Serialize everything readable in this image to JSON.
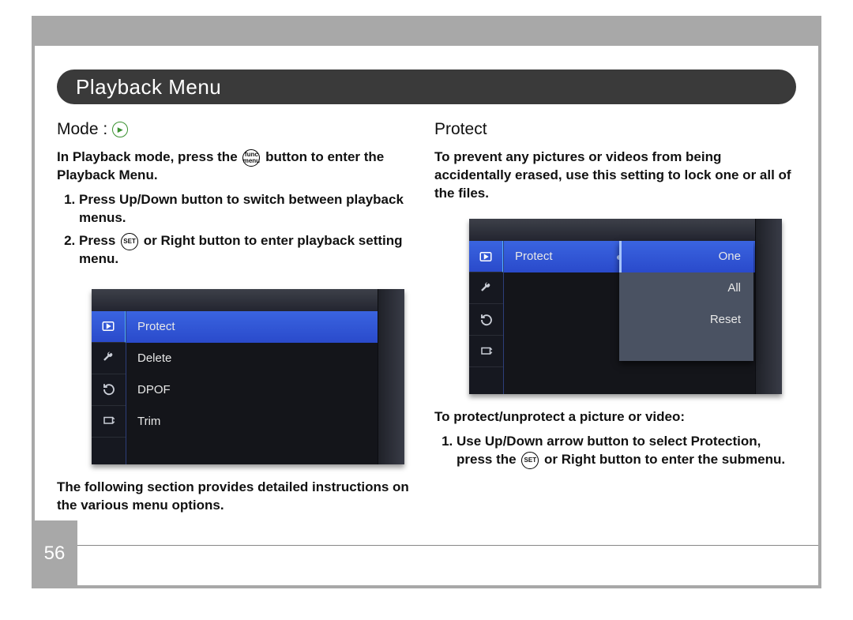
{
  "page_number": "56",
  "title": "Playback Menu",
  "left": {
    "mode_label": "Mode  :",
    "intro_a": "In Playback mode, press the ",
    "func_menu_label": "func\nmenu",
    "intro_b": " button to enter the Playback Menu.",
    "step1": "Press Up/Down button to switch between playback menus.",
    "step2_a": "Press ",
    "set_label": "SET",
    "step2_b": " or Right button to enter playback setting menu.",
    "outro": "The following section provides detailed instructions on the various menu options.",
    "lcd_items": [
      "Protect",
      "Delete",
      "DPOF",
      "Trim"
    ]
  },
  "right": {
    "section": "Protect",
    "intro": "To prevent any pictures or videos from being accidentally erased, use this setting to lock one or all of the files.",
    "lcd_menu_label": "Protect",
    "lcd_sub_items": [
      "One",
      "All",
      "Reset"
    ],
    "after": "To protect/unprotect a picture or video:",
    "step1_a": "Use Up/Down arrow button to select Protection, press the ",
    "set_label": "SET",
    "step1_b": " or Right button to enter the submenu."
  }
}
